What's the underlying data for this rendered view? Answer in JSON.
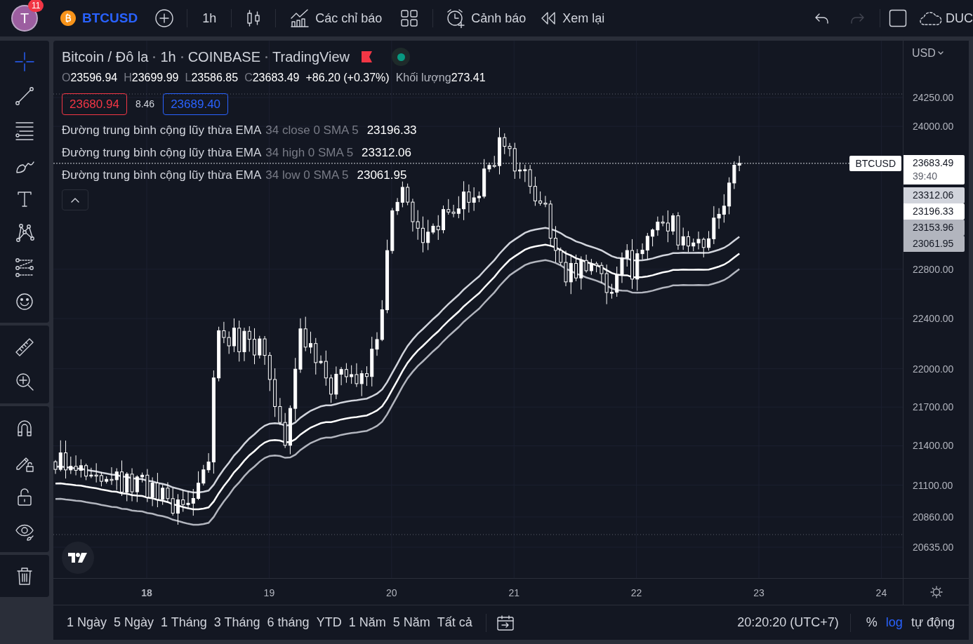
{
  "top_bar": {
    "avatar": {
      "initial": "T",
      "badge": "11"
    },
    "symbol": "BTCUSD",
    "interval": "1h",
    "tools": [
      {
        "kind": "indicators",
        "label": "Các chỉ báo"
      },
      {
        "kind": "templates"
      },
      {
        "kind": "alert",
        "label": "Cảnh báo"
      },
      {
        "kind": "replay",
        "label": "Xem lại"
      }
    ],
    "history": [
      {
        "kind": "undo",
        "disabled": false
      },
      {
        "kind": "redo",
        "disabled": true
      }
    ],
    "account": "DUC"
  },
  "left_toolbar": [
    [
      {
        "kind": "crosshair",
        "selected": true
      },
      {
        "kind": "trend-line",
        "selected": false
      },
      {
        "kind": "fib",
        "selected": false
      },
      {
        "kind": "brush",
        "selected": false
      },
      {
        "kind": "text",
        "selected": false
      },
      {
        "kind": "pattern",
        "selected": false
      },
      {
        "kind": "forecast",
        "selected": false
      },
      {
        "kind": "emoji",
        "selected": false
      }
    ],
    [
      {
        "kind": "ruler",
        "selected": false
      },
      {
        "kind": "zoom",
        "selected": false
      }
    ],
    [
      {
        "kind": "magnet",
        "selected": false
      },
      {
        "kind": "lock-drawing",
        "selected": false
      },
      {
        "kind": "lock",
        "selected": false
      },
      {
        "kind": "eye",
        "selected": false
      }
    ],
    [
      {
        "kind": "trash",
        "selected": false
      }
    ]
  ],
  "legend": {
    "title": [
      "Bitcoin / Đô la",
      "1h",
      "COINBASE",
      "TradingView"
    ],
    "ohlc": [
      {
        "label": "O",
        "value": "23596.94"
      },
      {
        "label": "H",
        "value": "23699.99"
      },
      {
        "label": "L",
        "value": "23586.85"
      },
      {
        "label": "C",
        "value": "23683.49"
      }
    ],
    "change": "+86.20 (+0.37%)",
    "volume": {
      "label": "Khối lượng",
      "value": "273.41"
    },
    "sell": "23680.94",
    "spread": "8.46",
    "buy": "23689.40",
    "indicators": [
      {
        "name": "Đường trung bình cộng lũy thừa EMA",
        "params": "34 close 0 SMA 5",
        "value": "23196.33"
      },
      {
        "name": "Đường trung bình cộng lũy thừa EMA",
        "params": "34 high 0 SMA 5",
        "value": "23312.06"
      },
      {
        "name": "Đường trung bình cộng lũy thừa EMA",
        "params": "34 low 0 SMA 5",
        "value": "23061.95"
      }
    ]
  },
  "price_axis": {
    "currency": "USD",
    "ticks": [
      "24250.00",
      "24000.00",
      "22800.00",
      "22400.00",
      "22000.00",
      "21700.00",
      "21400.00",
      "21100.00",
      "20860.00",
      "20635.00"
    ],
    "symbol_tag": "BTCUSD",
    "last_price": "23683.49",
    "countdown": "39:40",
    "labels": [
      {
        "value": "23312.06",
        "color": "#d1d4dc"
      },
      {
        "value": "23196.33",
        "color": "#ffffff"
      },
      {
        "value": "23153.96",
        "color": "#b2b5be"
      },
      {
        "value": "23061.95",
        "color": "#b2b5be"
      }
    ]
  },
  "time_axis": {
    "labels": [
      {
        "text": "18",
        "bold": true
      },
      {
        "text": "19",
        "bold": false
      },
      {
        "text": "20",
        "bold": false
      },
      {
        "text": "21",
        "bold": false
      },
      {
        "text": "22",
        "bold": false
      },
      {
        "text": "23",
        "bold": false
      },
      {
        "text": "24",
        "bold": false
      }
    ]
  },
  "bottom_bar": {
    "ranges": [
      "1 Ngày",
      "5 Ngày",
      "1 Tháng",
      "3 Tháng",
      "6 tháng",
      "YTD",
      "1 Năm",
      "5 Năm",
      "Tất cả"
    ],
    "clock": "20:20:20 (UTC+7)",
    "scale_options": [
      {
        "label": "%",
        "selected": false
      },
      {
        "label": "log",
        "selected": true
      },
      {
        "label": "tự động",
        "selected": false
      }
    ]
  }
}
